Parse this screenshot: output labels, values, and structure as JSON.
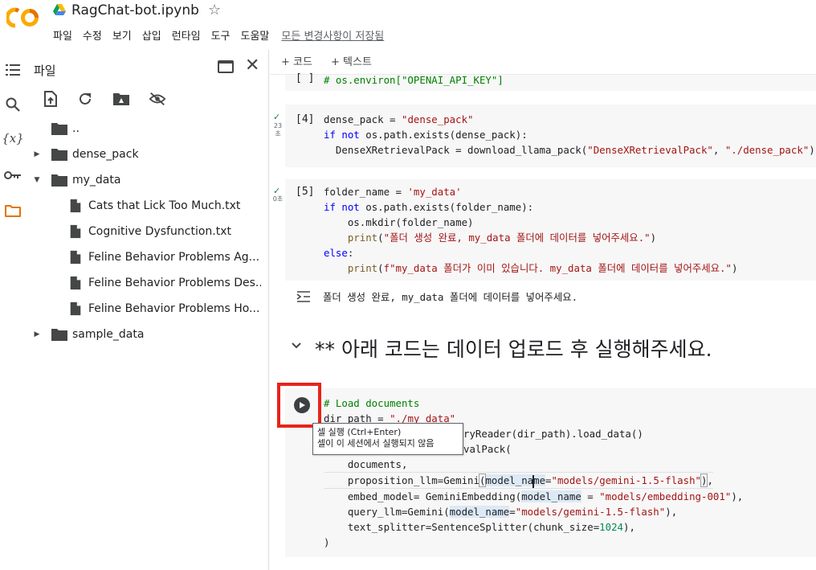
{
  "header": {
    "title": "RagChat-bot.ipynb",
    "menu": [
      "파일",
      "수정",
      "보기",
      "삽입",
      "런타임",
      "도구",
      "도움말"
    ],
    "saved_status": "모든 변경사항이 저장됨",
    "logo_text": "CO",
    "colors": {
      "logo_orange": "#f9ab00",
      "logo_dark": "#e37400"
    }
  },
  "rail": {
    "icons": [
      "table-of-contents-icon",
      "search-icon",
      "variables-icon",
      "key-icon",
      "folder-icon"
    ],
    "variables_label": "{x}"
  },
  "files": {
    "title": "파일",
    "toolbar": [
      "upload-icon",
      "refresh-icon",
      "drive-folder-icon",
      "hide-icon"
    ],
    "tree": [
      {
        "label": "..",
        "type": "folder",
        "depth": 0,
        "expandable": false
      },
      {
        "label": "dense_pack",
        "type": "folder",
        "depth": 0,
        "expandable": true,
        "expanded": false
      },
      {
        "label": "my_data",
        "type": "folder",
        "depth": 0,
        "expandable": true,
        "expanded": true
      },
      {
        "label": "Cats that Lick Too Much.txt",
        "type": "file",
        "depth": 1
      },
      {
        "label": "Cognitive Dysfunction.txt",
        "type": "file",
        "depth": 1
      },
      {
        "label": "Feline Behavior Problems Ag...",
        "type": "file",
        "depth": 1
      },
      {
        "label": "Feline Behavior Problems Des...",
        "type": "file",
        "depth": 1
      },
      {
        "label": "Feline Behavior Problems Ho...",
        "type": "file",
        "depth": 1
      },
      {
        "label": "sample_data",
        "type": "folder",
        "depth": 0,
        "expandable": true,
        "expanded": false
      }
    ]
  },
  "toolbar": {
    "add_code": "+ 코드",
    "add_text": "+ 텍스트"
  },
  "cells": {
    "top": {
      "count": "[ ]",
      "code": "# os.environ[\"OPENAI_API_KEY\"]"
    },
    "c4": {
      "count": "[4]",
      "duration": "23\n초",
      "lines": [
        "dense_pack = \"dense_pack\"",
        "if not os.path.exists(dense_pack):",
        "  DenseXRetrievalPack = download_llama_pack(\"DenseXRetrievalPack\", \"./dense_pack\")"
      ]
    },
    "c5": {
      "count": "[5]",
      "duration": "0초",
      "lines": [
        "folder_name = 'my_data'",
        "if not os.path.exists(folder_name):",
        "    os.mkdir(folder_name)",
        "    print(\"폴더 생성 완료, my_data 폴더에 데이터를 넣어주세요.\")",
        "else:",
        "    print(f\"my_data 폴더가 이미 있습니다. my_data 폴더에 데이터를 넣어주세요.\")"
      ],
      "output": "폴더 생성 완료, my_data 폴더에 데이터를 넣어주세요."
    },
    "section_title": "** 아래 코드는 데이터 업로드 후 실행해주세요.",
    "c6": {
      "lines": [
        "# Load documents",
        "dir_path = \"./my_data\"",
        "documents = SimpleDirectoryReader(dir_path).load_data()",
        "dense_pack = DenseXRetrievalPack(",
        "    documents,",
        "    proposition_llm=Gemini(model_name=\"models/gemini-1.5-flash\"),",
        "    embed_model= GeminiEmbedding(model_name = \"models/embedding-001\"),",
        "    query_llm=Gemini(model_name=\"models/gemini-1.5-flash\"),",
        "    text_splitter=SentenceSplitter(chunk_size=1024),",
        ")"
      ],
      "visible_fragments": {
        "line2": "dir_path = \"./my_data\"",
        "line3_tail": "ryReader(dir_path).load_data()",
        "line4_tail": "valPack("
      }
    }
  },
  "tooltip": {
    "line1": "셀 실행 (Ctrl+Enter)",
    "line2": "셀이 이 세션에서 실행되지 않음"
  }
}
